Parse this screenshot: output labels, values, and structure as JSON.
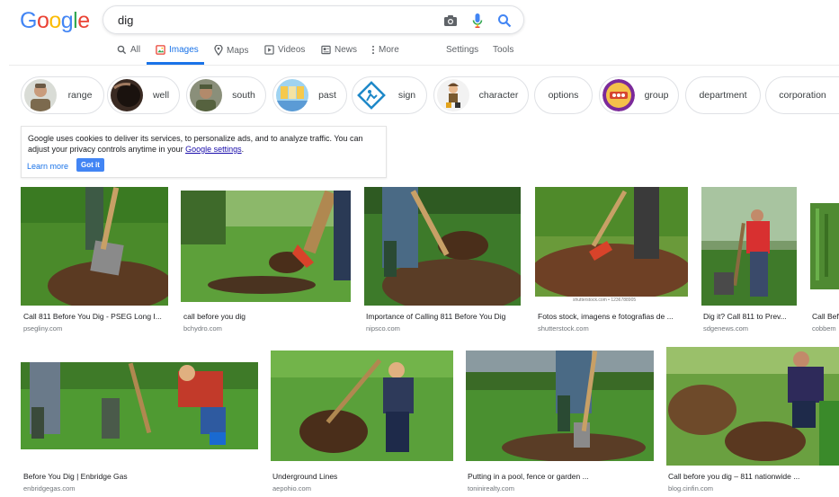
{
  "logo": {
    "letters": [
      "G",
      "o",
      "o",
      "g",
      "l",
      "e"
    ],
    "colors": [
      "#4285f4",
      "#ea4335",
      "#fbbc05",
      "#4285f4",
      "#34a853",
      "#ea4335"
    ]
  },
  "search": {
    "query": "dig",
    "icons": [
      "camera-icon",
      "mic-icon",
      "search-icon"
    ]
  },
  "tabs": [
    {
      "label": "All",
      "icon": "search-icon"
    },
    {
      "label": "Images",
      "icon": "image-icon"
    },
    {
      "label": "Maps",
      "icon": "map-pin-icon"
    },
    {
      "label": "Videos",
      "icon": "video-icon"
    },
    {
      "label": "News",
      "icon": "news-icon"
    },
    {
      "label": "More",
      "icon": "more-icon"
    },
    {
      "label": "Settings"
    },
    {
      "label": "Tools"
    }
  ],
  "chips": [
    "range",
    "well",
    "south",
    "past",
    "sign",
    "character",
    "options",
    "group",
    "department",
    "corporation"
  ],
  "cookie": {
    "text_before": "Google uses cookies to deliver its services, to personalize ads, and to analyze traffic. You can adjust your privacy controls anytime in your ",
    "link": "Google settings",
    "text_after": ".",
    "learn_more": "Learn more",
    "got_it": "Got it"
  },
  "results": [
    {
      "caption": "Call 811 Before You Dig - PSEG Long I...",
      "source": "psegliny.com"
    },
    {
      "caption": "call before you dig",
      "source": "bchydro.com"
    },
    {
      "caption": "Importance of Calling 811 Before You Dig",
      "source": "nipsco.com"
    },
    {
      "caption": "Fotos stock, imagens e fotografias de ...",
      "source": "shutterstock.com"
    },
    {
      "caption": "Dig it? Call 811 to Prev...",
      "source": "sdgenews.com"
    },
    {
      "caption": "Call Bef",
      "source": "cobbem"
    },
    {
      "caption": "Before You Dig | Enbridge Gas",
      "source": "enbridgegas.com"
    },
    {
      "caption": "Underground Lines",
      "source": "aepohio.com"
    },
    {
      "caption": "Putting in a pool, fence or garden ...",
      "source": "toninirealty.com"
    },
    {
      "caption": "Call before you dig – 811 nationwide ...",
      "source": "blog.cinfin.com"
    }
  ],
  "watermark": "shutterstock.com • 1236788905"
}
